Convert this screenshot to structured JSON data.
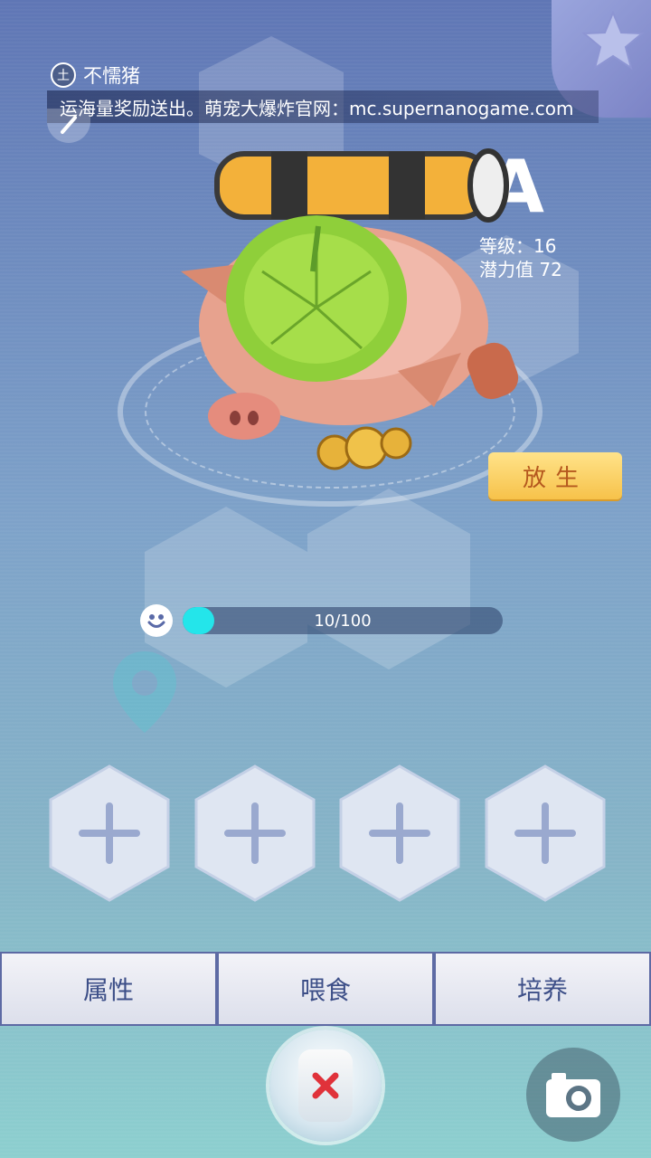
{
  "owner": {
    "badge": "土",
    "name": "不懦猪"
  },
  "ticker": {
    "text": "运海量奖励送出。萌宠大爆炸官网：mc.supernanogame.com"
  },
  "pet": {
    "grade": "A",
    "level_label": "等级：16",
    "power_label": "潜力值  72",
    "release_label": "放生"
  },
  "mood": {
    "value": 10,
    "max": 100,
    "text": "10/100"
  },
  "slots": [
    "+",
    "+",
    "+",
    "+"
  ],
  "tabs": [
    {
      "label": "属性"
    },
    {
      "label": "喂食"
    },
    {
      "label": "培养"
    }
  ],
  "colors": {
    "accent": "#24e5ea",
    "tab_text": "#3d4f88",
    "release_bg": "#f7c24a"
  },
  "icons": {
    "close": "close-icon",
    "camera": "camera-icon",
    "star": "star-icon",
    "mood": "smiley-icon"
  }
}
